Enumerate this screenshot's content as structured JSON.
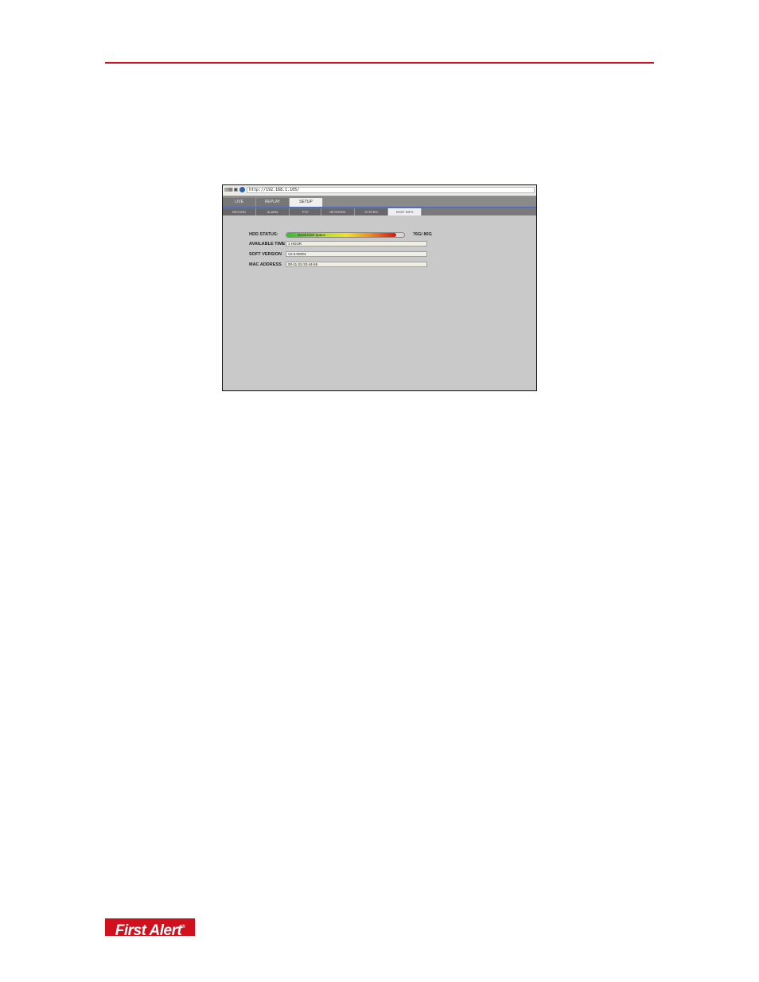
{
  "colors": {
    "accent": "#d0101c",
    "panel_bg": "#c9c9c9",
    "tab_bar": "#8a8a8a"
  },
  "browser": {
    "address": "http://192.168.1.105/"
  },
  "main_tabs": [
    {
      "label": "LIVE"
    },
    {
      "label": "REPLAY"
    },
    {
      "label": "SETUP"
    }
  ],
  "sub_tabs": [
    {
      "label": "RECORD"
    },
    {
      "label": "ALARM"
    },
    {
      "label": "PTZ"
    },
    {
      "label": "NETWORK"
    },
    {
      "label": "SYSTEM"
    },
    {
      "label": "HOST INFO"
    }
  ],
  "host_info": {
    "hdd_status_label": "HDD STATUS:",
    "hdd_status_text": "Good Disk Space",
    "hdd_used_fraction": 0.93,
    "hdd_size": "76G/ 80G",
    "available_time_label": "AVAILABLE TIME",
    "available_time_value": "1 HOUR",
    "soft_version_label": "SOFT VERSION",
    "soft_version_value": "V2.0.00001",
    "mac_address_label": "MAC ADDRESS",
    "mac_address_value": "00-11-22-33-44-55"
  },
  "footer": {
    "logo_text": "First Alert",
    "logo_mark": "®"
  }
}
